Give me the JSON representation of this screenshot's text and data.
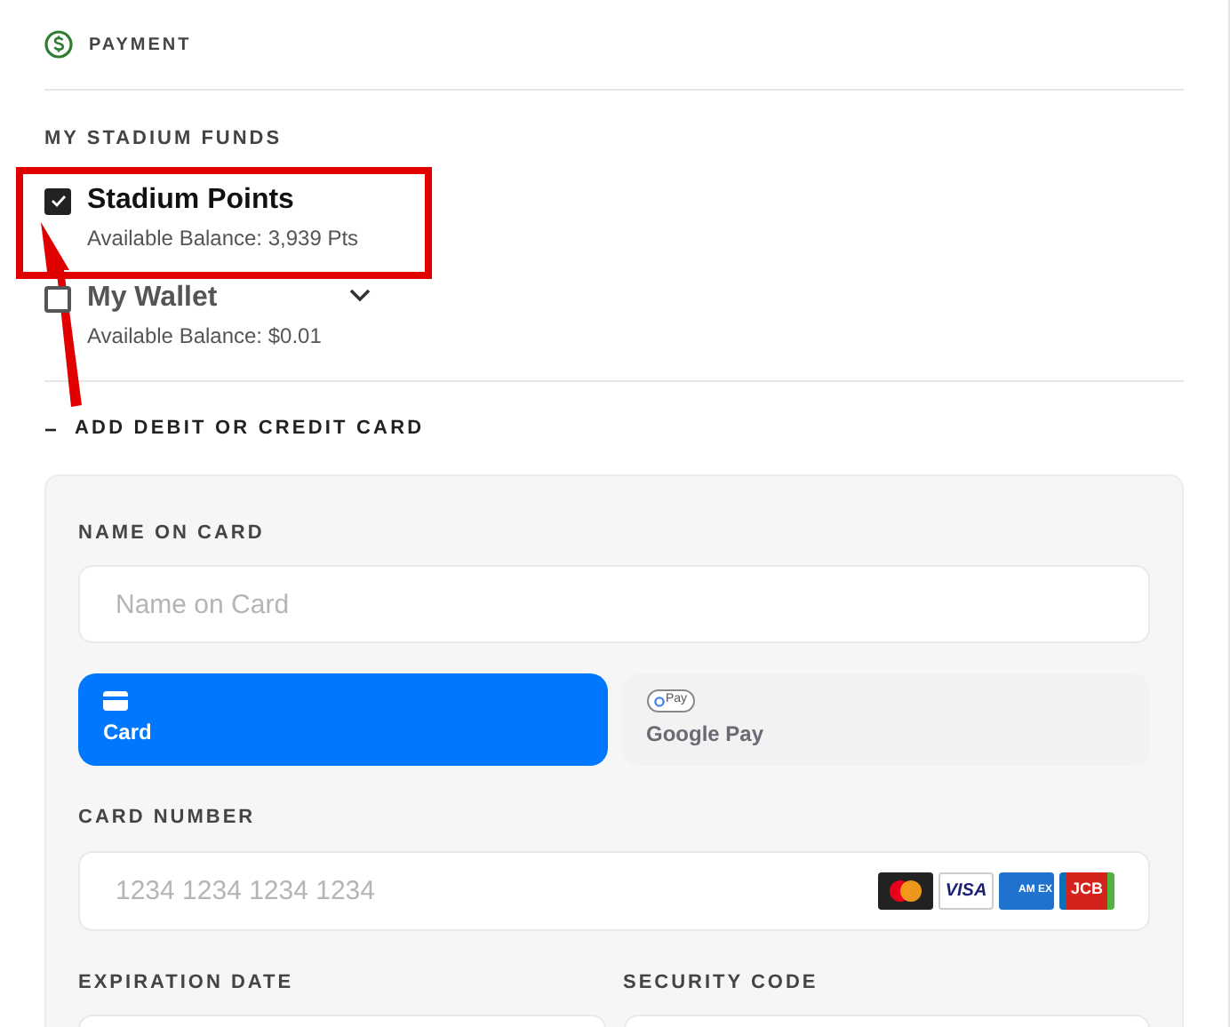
{
  "header": {
    "title": "PAYMENT"
  },
  "funds": {
    "heading": "MY STADIUM FUNDS",
    "items": [
      {
        "name": "Stadium Points",
        "balance": "Available Balance: 3,939 Pts",
        "checked": true,
        "highlighted": true,
        "expandable": false
      },
      {
        "name": "My Wallet",
        "balance": "Available Balance: $0.01",
        "checked": false,
        "highlighted": false,
        "expandable": true
      }
    ]
  },
  "add_card": {
    "toggle": "−",
    "label": "ADD DEBIT OR CREDIT CARD",
    "expanded": true
  },
  "form": {
    "name_label": "NAME ON CARD",
    "name_placeholder": "Name on Card",
    "methods": [
      {
        "kind": "card",
        "label": "Card",
        "selected": true
      },
      {
        "kind": "gpay",
        "label": "Google Pay",
        "badge": "Pay",
        "selected": false
      }
    ],
    "number_label": "CARD NUMBER",
    "number_placeholder": "1234 1234 1234 1234",
    "brands": [
      {
        "kind": "mastercard"
      },
      {
        "kind": "visa",
        "label": "VISA"
      },
      {
        "kind": "amex",
        "label": "AM EX"
      },
      {
        "kind": "jcb",
        "label": "JCB"
      }
    ],
    "expiry_label": "EXPIRATION DATE",
    "security_label": "SECURITY CODE"
  }
}
